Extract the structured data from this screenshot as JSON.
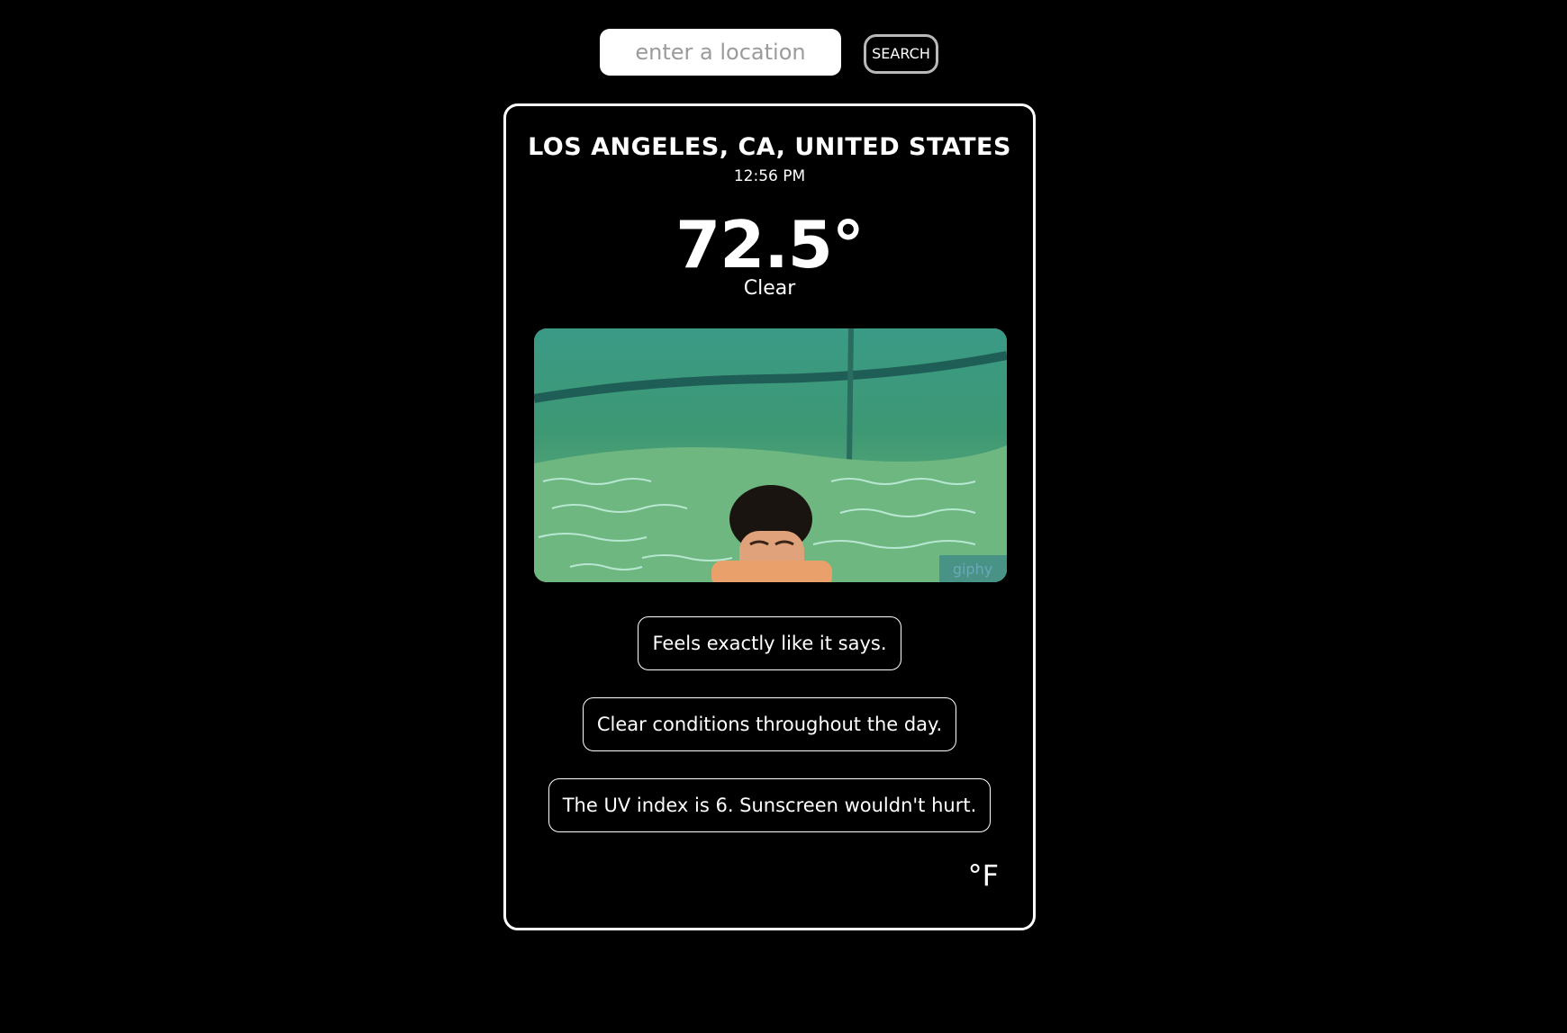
{
  "search": {
    "placeholder": "enter a location",
    "button_label": "SEARCH"
  },
  "weather": {
    "location": "LOS ANGELES, CA, UNITED STATES",
    "time": "12:56 PM",
    "temperature": "72.5°",
    "condition": "Clear",
    "image_watermark": "giphy",
    "messages": [
      "Feels exactly like it says.",
      "Clear conditions throughout the day.",
      "The UV index is 6. Sunscreen wouldn't hurt."
    ],
    "unit": "°F"
  }
}
